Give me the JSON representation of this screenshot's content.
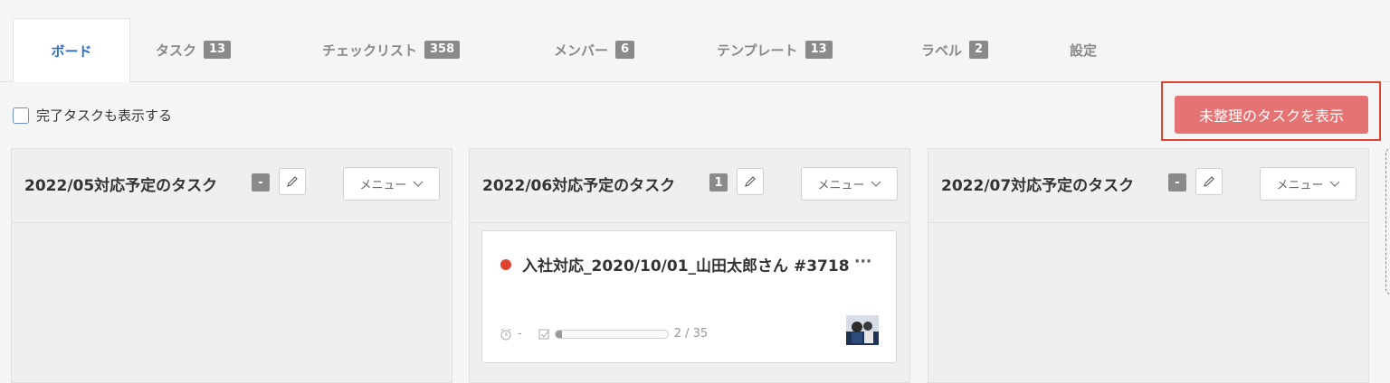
{
  "tabs": [
    {
      "label": "ボード",
      "badge": null,
      "active": true
    },
    {
      "label": "タスク",
      "badge": "13"
    },
    {
      "label": "チェックリスト",
      "badge": "358"
    },
    {
      "label": "メンバー",
      "badge": "6"
    },
    {
      "label": "テンプレート",
      "badge": "13"
    },
    {
      "label": "ラベル",
      "badge": "2"
    },
    {
      "label": "設定",
      "badge": null
    }
  ],
  "filter": {
    "show_completed_label": "完了タスクも表示する",
    "checked": false
  },
  "unsorted_button_label": "未整理のタスクを表示",
  "columns": [
    {
      "title": "2022/05対応予定のタスク",
      "count": "-",
      "menu_label": "メニュー",
      "cards": []
    },
    {
      "title": "2022/06対応予定のタスク",
      "count": "1",
      "menu_label": "メニュー",
      "cards": [
        {
          "title": "入社対応_2020/10/01_山田太郎さん #3718",
          "more": "···",
          "due": "-",
          "progress_text": "2 / 35",
          "progress_fraction": 0.057,
          "dot_color": "#e0432f"
        }
      ]
    },
    {
      "title": "2022/07対応予定のタスク",
      "count": "-",
      "menu_label": "メニュー",
      "cards": []
    }
  ],
  "colors": {
    "accent": "#2f6fcc",
    "primary_button": "#e57373",
    "highlight": "#e0432f"
  },
  "icons": {
    "edit": "pencil-icon",
    "menu_chevron": "chevron-down-icon",
    "clock": "alarm-clock-icon",
    "checklist": "checkbox-icon"
  }
}
